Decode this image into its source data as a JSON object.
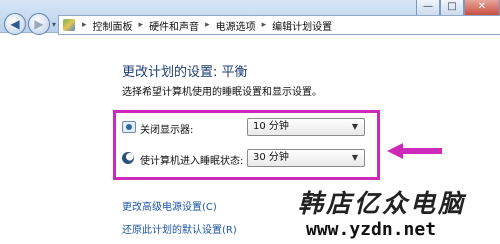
{
  "window": {
    "minimize_glyph": "—",
    "maximize_glyph": "□",
    "close_glyph": "✕"
  },
  "navigation": {
    "back_icon": "back-arrow-icon",
    "forward_icon": "forward-arrow-icon",
    "dropdown_glyph": "▾"
  },
  "address_bar": {
    "breadcrumbs": [
      "控制面板",
      "硬件和声音",
      "电源选项",
      "编辑计划设置"
    ],
    "separator": "▸"
  },
  "main": {
    "title": "更改计划的设置: 平衡",
    "subtitle": "选择希望计算机使用的睡眠设置和显示设置。",
    "settings": [
      {
        "icon": "monitor-icon",
        "label": "关闭显示器:",
        "value": "10 分钟"
      },
      {
        "icon": "sleep-moon-icon",
        "label": "使计算机进入睡眠状态:",
        "value": "30 分钟"
      }
    ],
    "links": {
      "advanced": "更改高级电源设置(C)",
      "restore": "还原此计划的默认设置(R)"
    }
  },
  "annotation": {
    "highlight_color": "#cc2ab8",
    "arrow_color": "#cc2ab8"
  },
  "watermark": {
    "name": "韩店亿众电脑",
    "url": "www.yzdn.net"
  }
}
